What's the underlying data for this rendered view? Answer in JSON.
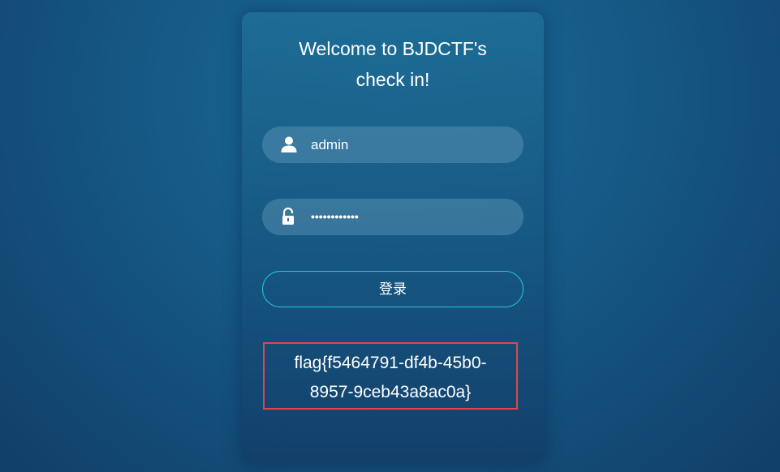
{
  "login": {
    "title_line1": "Welcome to BJDCTF's",
    "title_line2": "check in!",
    "username_value": "admin",
    "password_value": "••••••••••••",
    "submit_label": "登录"
  },
  "flag": {
    "line1": "flag{f5464791-df4b-45b0-",
    "line2": "8957-9ceb43a8ac0a}"
  },
  "icons": {
    "username": "user-icon",
    "password": "unlock-icon"
  },
  "colors": {
    "button_border": "#27c6e8",
    "highlight_box": "#e64545"
  }
}
